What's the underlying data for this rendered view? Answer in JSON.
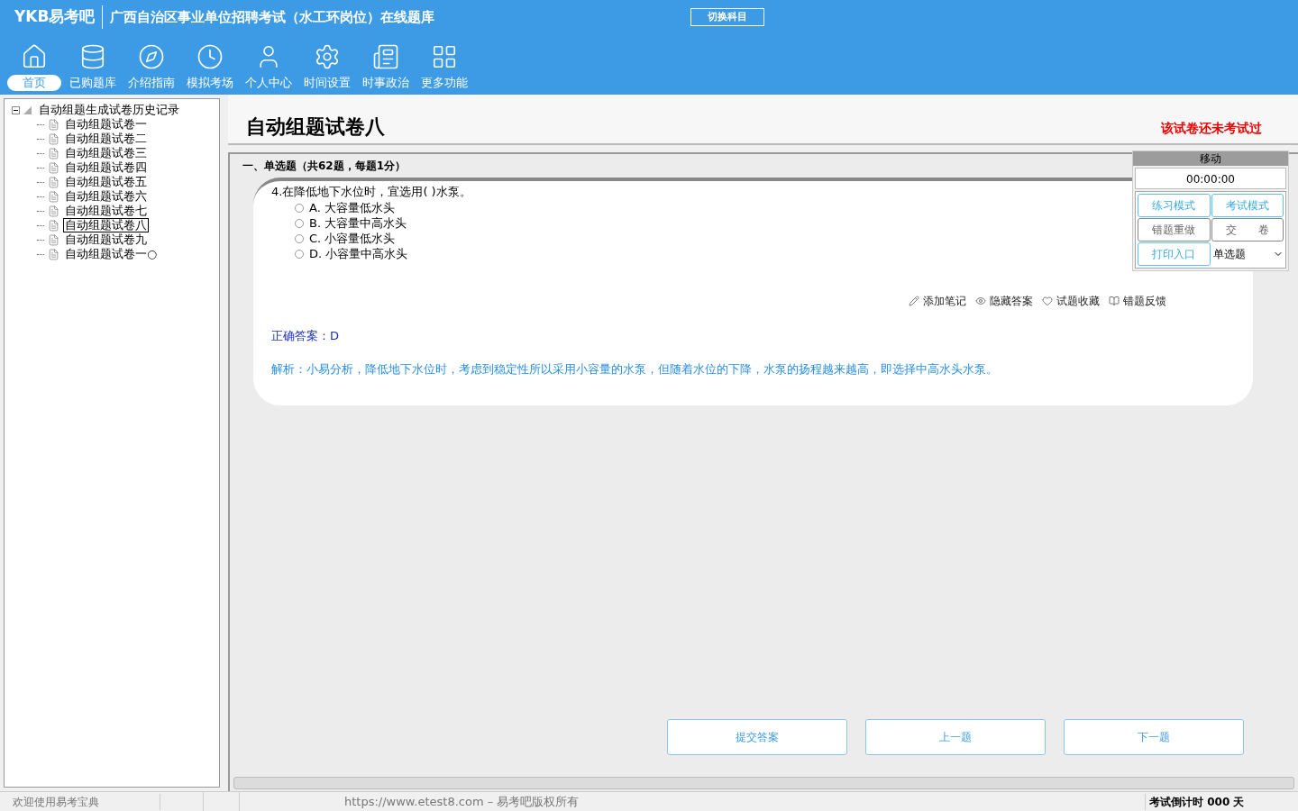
{
  "header": {
    "logo": "YKB易考吧",
    "title": "广西自治区事业单位招聘考试（水工环岗位）在线题库",
    "switch_button": "切换科目"
  },
  "nav": [
    {
      "label": "首页",
      "selected": true
    },
    {
      "label": "已购题库",
      "selected": false
    },
    {
      "label": "介绍指南",
      "selected": false
    },
    {
      "label": "模拟考场",
      "selected": false
    },
    {
      "label": "个人中心",
      "selected": false
    },
    {
      "label": "时间设置",
      "selected": false
    },
    {
      "label": "时事政治",
      "selected": false
    },
    {
      "label": "更多功能",
      "selected": false
    }
  ],
  "tree": {
    "label": "自动组题生成试卷历史记录",
    "expanded": true,
    "children": [
      {
        "label": "自动组题试卷一",
        "selected": false
      },
      {
        "label": "自动组题试卷二",
        "selected": false
      },
      {
        "label": "自动组题试卷三",
        "selected": false
      },
      {
        "label": "自动组题试卷四",
        "selected": false
      },
      {
        "label": "自动组题试卷五",
        "selected": false
      },
      {
        "label": "自动组题试卷六",
        "selected": false
      },
      {
        "label": "自动组题试卷七",
        "selected": false
      },
      {
        "label": "自动组题试卷八",
        "selected": true
      },
      {
        "label": "自动组题试卷九",
        "selected": false
      },
      {
        "label": "自动组题试卷一○",
        "selected": false
      }
    ]
  },
  "paper": {
    "title": "自动组题试卷八",
    "status": "该试卷还未考试过",
    "section": "一、单选题（共62题，每题1分）"
  },
  "question": {
    "stem": "4.在降低地下水位时，宜选用( )水泵。",
    "options": [
      {
        "label": "A. 大容量低水头",
        "checked": false
      },
      {
        "label": "B. 大容量中高水头",
        "checked": false
      },
      {
        "label": "C. 小容量低水头",
        "checked": false
      },
      {
        "label": "D. 小容量中高水头",
        "checked": false
      }
    ],
    "actions": [
      "添加笔记",
      "隐藏答案",
      "试题收藏",
      "错题反馈"
    ],
    "answer": "正确答案：D",
    "analysis": "解析：小易分析，降低地下水位时，考虑到稳定性所以采用小容量的水泵，但随着水位的下降，水泵的扬程越来越高，即选择中高水头水泵。"
  },
  "panel": {
    "title": "移动",
    "timer": "00:00:00",
    "buttons": [
      {
        "label": "练习模式",
        "kind": "primary"
      },
      {
        "label": "考试模式",
        "kind": "primary"
      },
      {
        "label": "错题重做",
        "kind": "neutral"
      },
      {
        "label": "交　　卷",
        "kind": "neutral"
      },
      {
        "label": "打印入口",
        "kind": "primary"
      }
    ],
    "type_select": "单选题"
  },
  "bottom_buttons": [
    "提交答案",
    "上一题",
    "下一题"
  ],
  "status_bar": {
    "welcome": "欢迎使用易考宝典",
    "copyright": "https://www.etest8.com – 易考吧版权所有",
    "countdown": "考试倒计时 000 天"
  }
}
